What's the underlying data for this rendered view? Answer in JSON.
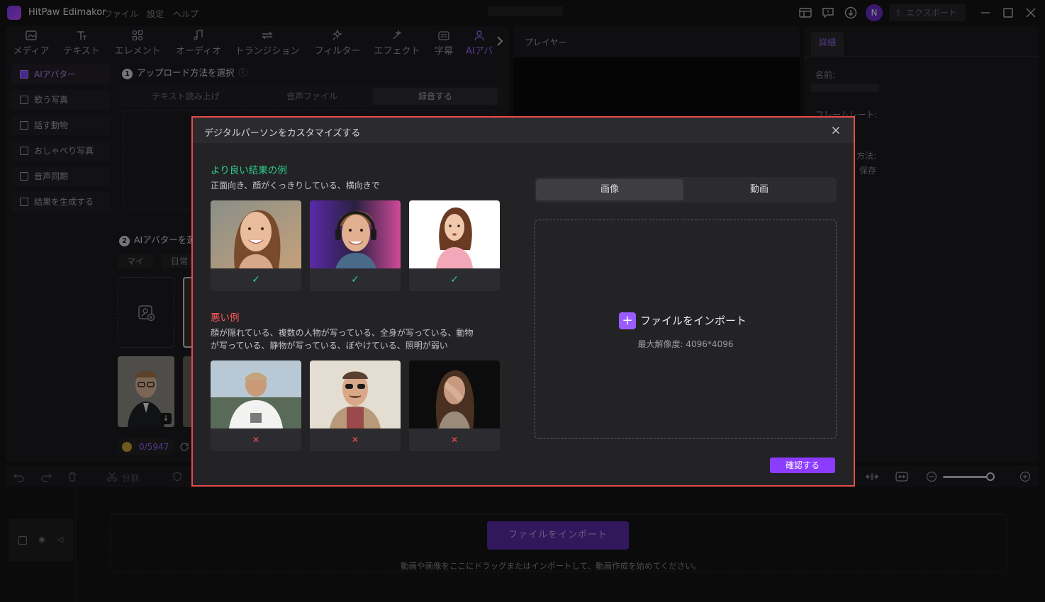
{
  "app": {
    "name": "HitPaw Edimakor",
    "avatar_letter": "N",
    "export_label": "エクスポート"
  },
  "menu": [
    "ファイル",
    "設定",
    "ヘルプ"
  ],
  "tool_tabs": [
    {
      "label": "メディア",
      "icon": "media-icon"
    },
    {
      "label": "テキスト",
      "icon": "text-icon"
    },
    {
      "label": "エレメント",
      "icon": "element-icon"
    },
    {
      "label": "オーディオ",
      "icon": "audio-icon"
    },
    {
      "label": "トランジション",
      "icon": "transition-icon"
    },
    {
      "label": "フィルター",
      "icon": "filter-icon"
    },
    {
      "label": "エフェクト",
      "icon": "effect-icon"
    },
    {
      "label": "字幕",
      "icon": "subtitle-icon"
    },
    {
      "label": "AIアバ",
      "icon": "ai-avatar-icon"
    }
  ],
  "sidebar": [
    {
      "label": "AIアバター",
      "active": true
    },
    {
      "label": "歌う写真"
    },
    {
      "label": "話す動物"
    },
    {
      "label": "おしゃべり写真"
    },
    {
      "label": "音声同期"
    },
    {
      "label": "結果を生成する"
    }
  ],
  "left_content": {
    "step1_num": "1",
    "step1_title": "アップロード方法を選択",
    "upload_modes": [
      "テキスト読み上げ",
      "音声ファイル",
      "録音する"
    ],
    "step2_num": "2",
    "step2_title": "AIアバターを選",
    "avatar_tabs": [
      "マイ",
      "日常"
    ],
    "credits": "0/5947"
  },
  "player": {
    "label": "プレイヤー"
  },
  "details": {
    "tab": "詳細",
    "name_label": "名前:",
    "frame_rate_label": "フレームレート:",
    "method_label": "方法:",
    "save_label": "保存"
  },
  "timeline": {
    "split_label": "分割",
    "import_button": "ファイルをインポート",
    "hint": "動画や画像をここにドラッグまたはインポートして、動画作成を始めてください。"
  },
  "modal": {
    "title": "デジタルパーソンをカスタマイズする",
    "good_title": "より良い結果の例",
    "good_desc": "正面向き、顔がくっきりしている、横向きで",
    "bad_title": "悪い例",
    "bad_desc_line1": "顔が隠れている、複数の人物が写っている、全身が写っている、動物",
    "bad_desc_line2": "が写っている、静物が写っている、ぼやけている、照明が弱い",
    "tabs": [
      "画像",
      "動画"
    ],
    "import_label": "ファイルをインポート",
    "max_resolution": "最大解像度: 4096*4096",
    "confirm": "確認する"
  },
  "colors": {
    "accent": "#8b3cff",
    "good": "#2ecf8a",
    "bad": "#ff5a5a",
    "highlight_border": "#e34c48"
  }
}
